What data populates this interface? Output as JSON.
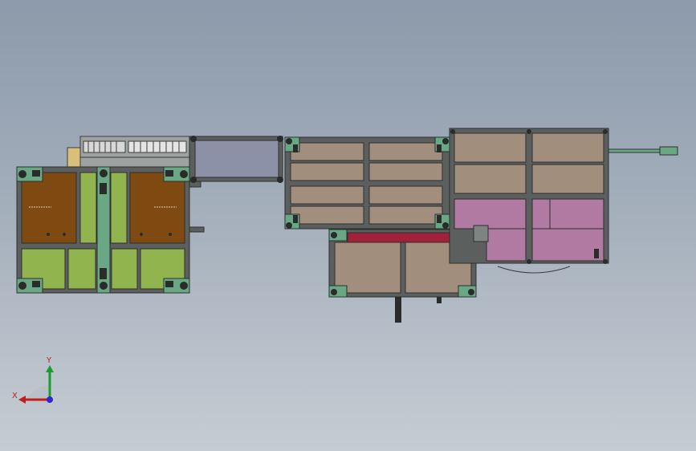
{
  "viewport": {
    "colors": {
      "frame": "#5b5f5e",
      "frame_dark": "#3b3d3c",
      "wood": "#a28e7c",
      "wood_dark": "#7e4a12",
      "lime": "#92b44e",
      "teal": "#6aa885",
      "purple": "#b07aa3",
      "crimson": "#a1213a",
      "slate": "#8d91a8"
    }
  },
  "triad": {
    "x_label": "X",
    "y_label": "Y"
  }
}
